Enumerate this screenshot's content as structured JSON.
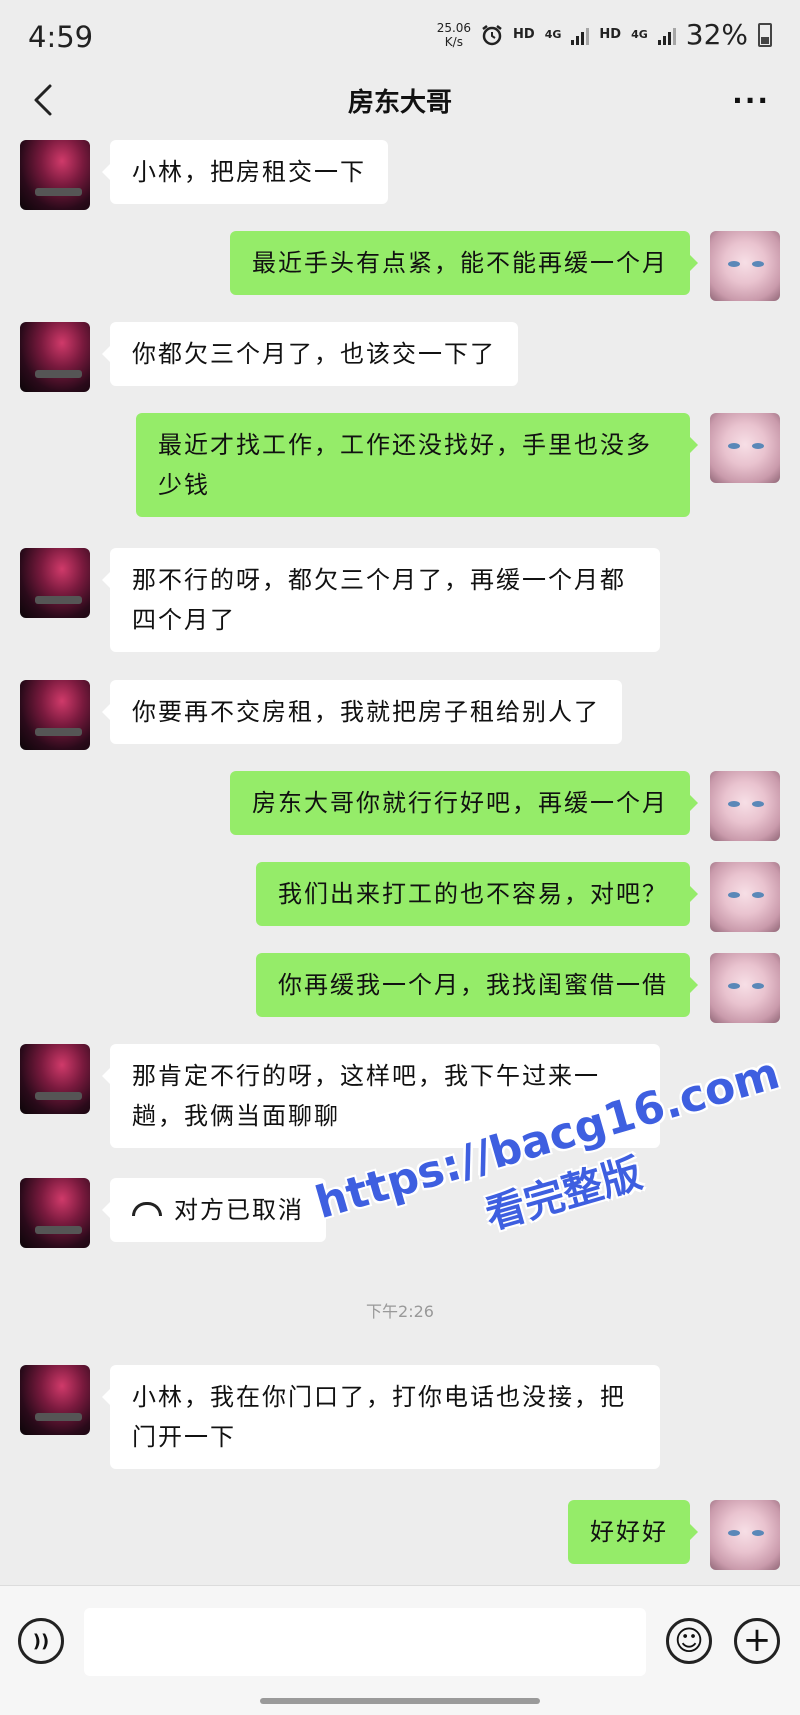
{
  "status_bar": {
    "time": "4:59",
    "net_speed_value": "25.06",
    "net_speed_unit": "K/s",
    "hd_1": "HD",
    "network_1": "4G",
    "hd_2": "HD",
    "network_2": "4G",
    "battery_percent": "32%"
  },
  "header": {
    "back_icon": "chevron-left",
    "title": "房东大哥",
    "more_icon": "more-dots",
    "more_label": "···"
  },
  "messages": [
    {
      "sender": "landlord",
      "text": "小林，把房租交一下"
    },
    {
      "sender": "me",
      "text": "最近手头有点紧，能不能再缓一个月"
    },
    {
      "sender": "landlord",
      "text": "你都欠三个月了，也该交一下了"
    },
    {
      "sender": "me",
      "text": "最近才找工作，工作还没找好，手里也没多少钱"
    },
    {
      "sender": "landlord",
      "text": "那不行的呀，都欠三个月了，再缓一个月都四个月了"
    },
    {
      "sender": "landlord",
      "text": "你要再不交房租，我就把房子租给别人了"
    },
    {
      "sender": "me",
      "text": "房东大哥你就行行好吧，再缓一个月"
    },
    {
      "sender": "me",
      "text": "我们出来打工的也不容易，对吧？"
    },
    {
      "sender": "me",
      "text": "你再缓我一个月，我找闺蜜借一借"
    },
    {
      "sender": "landlord",
      "text": "那肯定不行的呀，这样吧，我下午过来一趟，我俩当面聊聊"
    },
    {
      "sender": "landlord",
      "type": "call",
      "icon": "phone-hangup",
      "text": "对方已取消"
    },
    {
      "sender": "landlord",
      "text": "小林，我在你门口了，打你电话也没接，把门开一下"
    },
    {
      "sender": "me",
      "text": "好好好"
    }
  ],
  "time_divider": "下午2:26",
  "watermark": {
    "url": "https://bacg16.com",
    "subtitle": "看完整版",
    "color": "#3e5fe0"
  },
  "input_bar": {
    "voice_icon": "voice-icon",
    "emoji_icon": "emoji-icon",
    "plus_icon": "plus-icon",
    "voice_label": "))",
    "emoji_label": "☺",
    "plus_label": "+"
  },
  "colors": {
    "background": "#ededed",
    "bubble_in": "#ffffff",
    "bubble_out": "#95ec69"
  }
}
